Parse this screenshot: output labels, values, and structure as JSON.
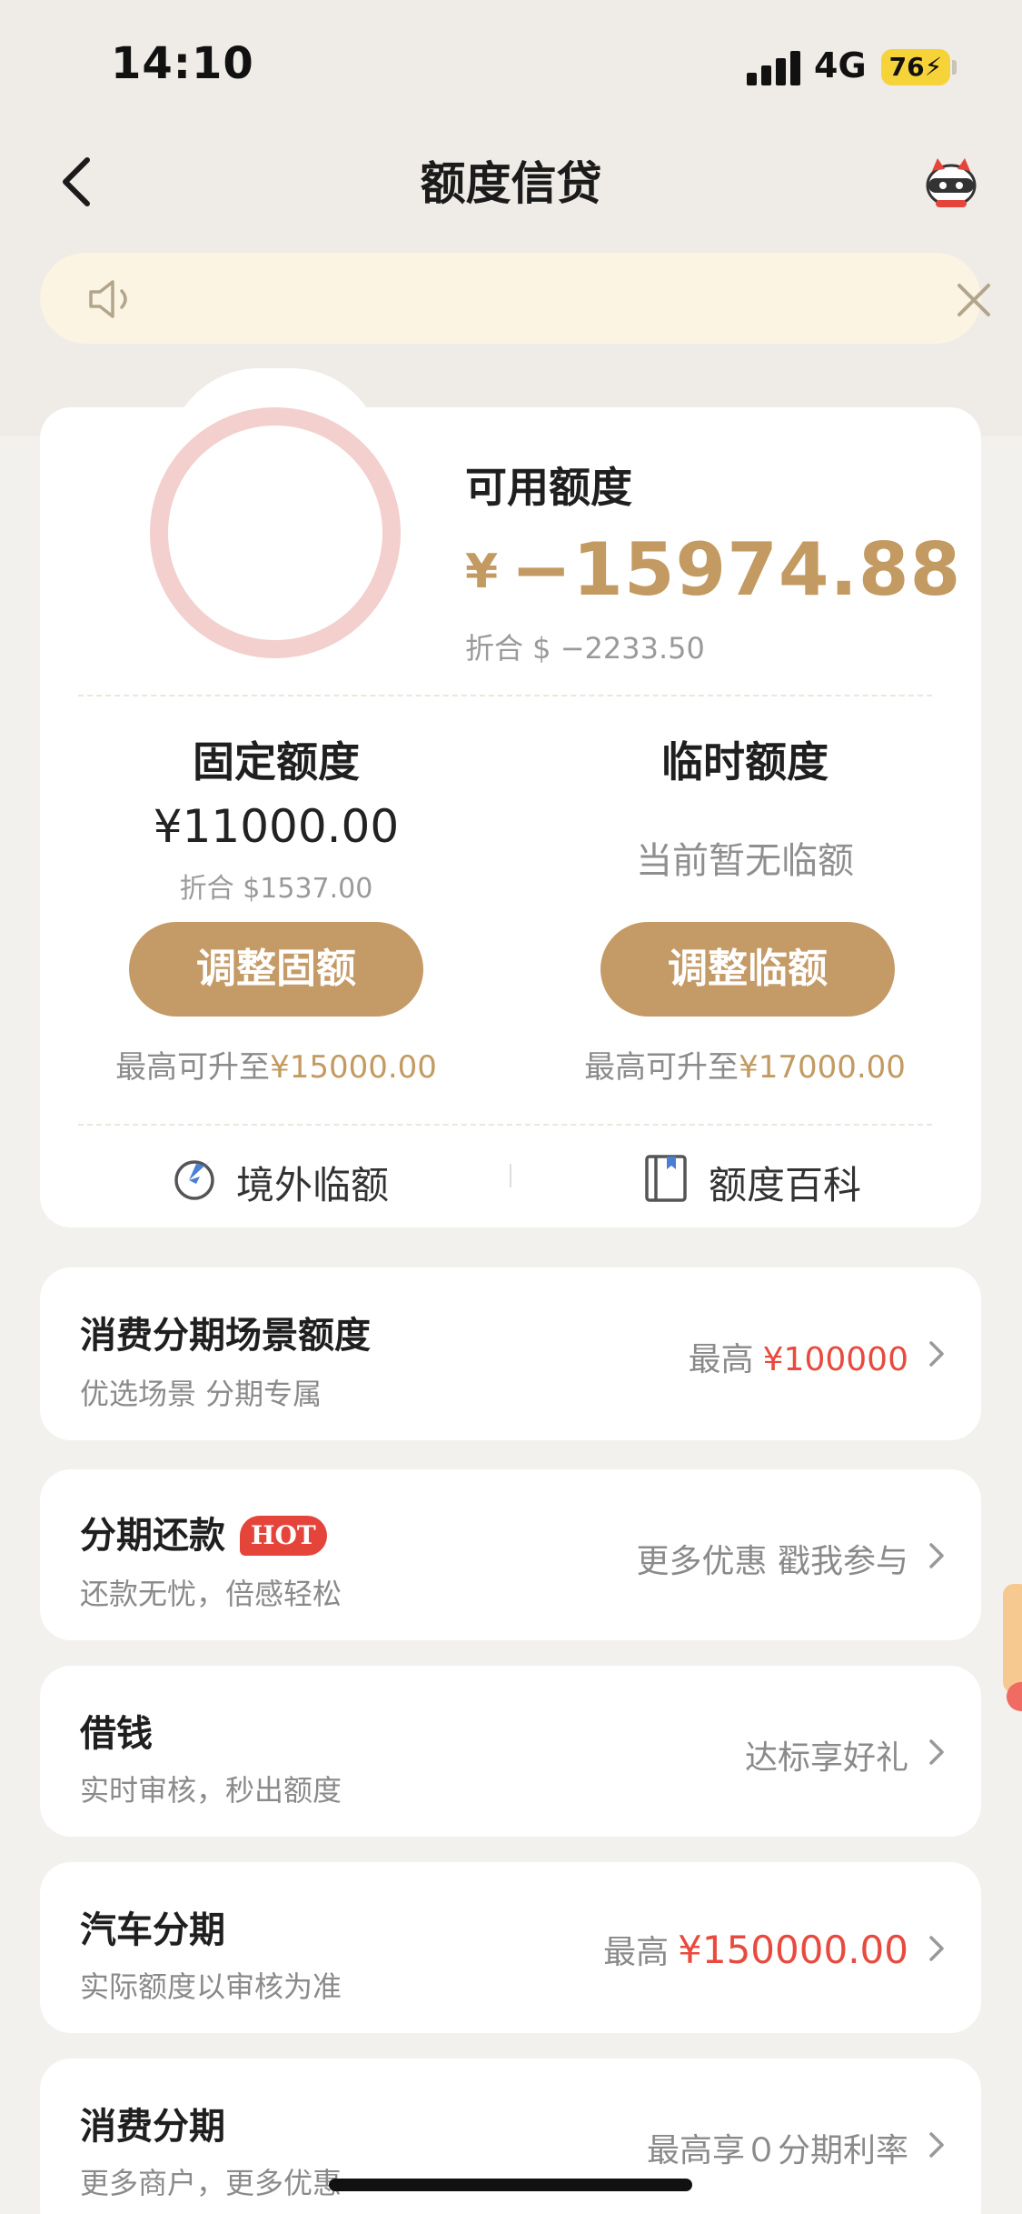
{
  "status_bar": {
    "time": "14:10",
    "network": "4G",
    "battery": "76"
  },
  "nav": {
    "title": "额度信贷"
  },
  "notice": {
    "text": ""
  },
  "credit": {
    "available_label": "可用额度",
    "currency_symbol": "¥",
    "available_amount": "−15974.88",
    "available_usd": "折合 $ −2233.50"
  },
  "fixed": {
    "title": "固定额度",
    "amount": "¥11000.00",
    "usd": "折合 $1537.00",
    "button": "调整固额",
    "max_prefix": "最高可升至",
    "max_value": "¥15000.00"
  },
  "temporary": {
    "title": "临时额度",
    "status": "当前暂无临额",
    "button": "调整临额",
    "max_prefix": "最高可升至",
    "max_value": "¥17000.00"
  },
  "tools": [
    {
      "label": "境外临额",
      "icon": "plane-globe-icon"
    },
    {
      "label": "额度百科",
      "icon": "book-icon"
    }
  ],
  "list": [
    {
      "title": "消费分期场景额度",
      "subtitle": "优选场景 分期专属",
      "right_prefix": "最高",
      "right_value": "¥100000"
    },
    {
      "title": "分期还款",
      "badge": "HOT",
      "subtitle": "还款无忧，倍感轻松",
      "right_prefix": "更多优惠 戳我参与"
    },
    {
      "title": "借钱",
      "subtitle": "实时审核，秒出额度",
      "right_prefix": "达标享好礼"
    },
    {
      "title": "汽车分期",
      "subtitle": "实际额度以审核为准",
      "right_prefix": "最高",
      "right_value": "¥150000.00"
    },
    {
      "title": "消费分期",
      "subtitle": "更多商户，更多优惠",
      "right_prefix": "最高享０分期利率"
    }
  ],
  "colors": {
    "accent_gold": "#c49a66",
    "highlight_red": "#e84a3e",
    "ring_pink": "#f3cfcd"
  }
}
